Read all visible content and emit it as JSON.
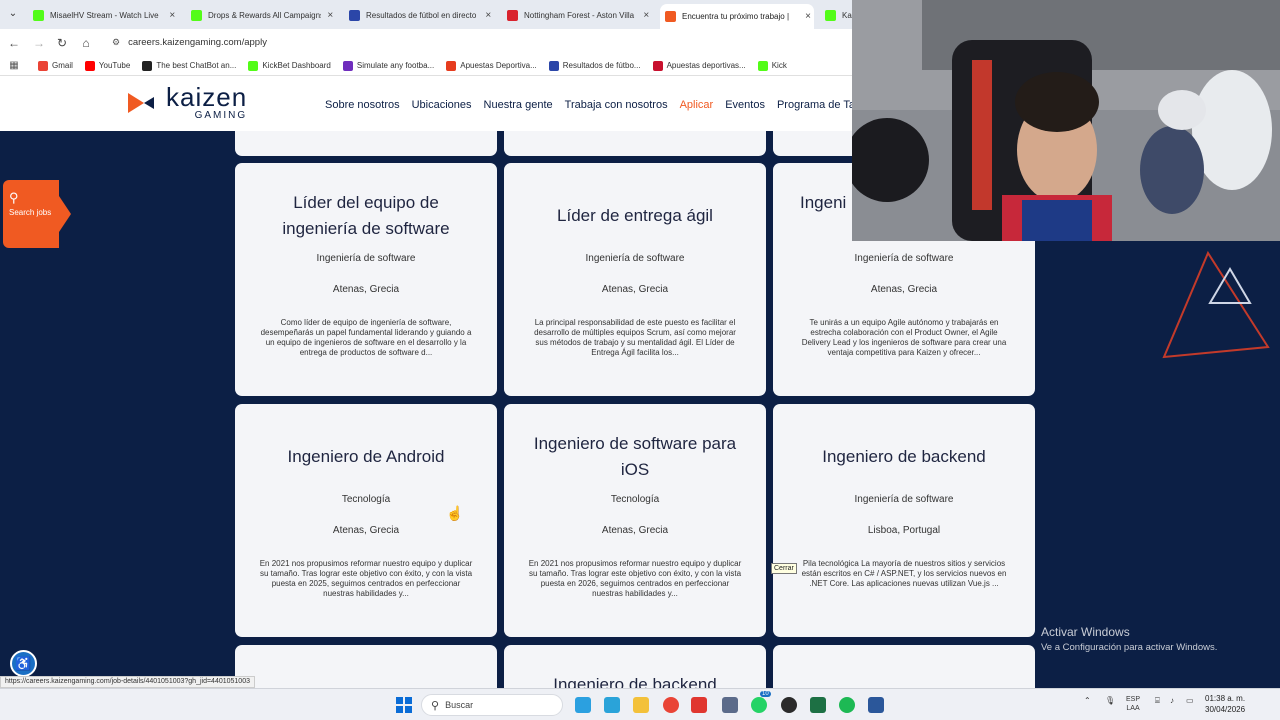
{
  "browser": {
    "tabs": [
      {
        "title": "MisaelHV Stream - Watch Live",
        "color": "#53fc18",
        "active": false
      },
      {
        "title": "Drops & Rewards All Campaigns",
        "color": "#53fc18",
        "active": false
      },
      {
        "title": "Resultados de fútbol en directo",
        "color": "#2b46a8",
        "active": false
      },
      {
        "title": "Nottingham Forest - Aston Villa",
        "color": "#d9232e",
        "active": false
      },
      {
        "title": "Encuentra tu próximo trabajo |",
        "color": "#f05a22",
        "active": true
      },
      {
        "title": "Ka",
        "color": "#53fc18",
        "active": false
      }
    ],
    "url": "careers.kaizengaming.com/apply",
    "bookmarks": [
      {
        "label": "Gmail",
        "color": "#ea4335"
      },
      {
        "label": "YouTube",
        "color": "#ff0000"
      },
      {
        "label": "The best ChatBot an...",
        "color": "#222222"
      },
      {
        "label": "KickBet Dashboard",
        "color": "#53fc18"
      },
      {
        "label": "Simulate any footba...",
        "color": "#6f2dbd"
      },
      {
        "label": "Apuestas Deportiva...",
        "color": "#e63c1e"
      },
      {
        "label": "Resultados de fútbo...",
        "color": "#2b46a8"
      },
      {
        "label": "Apuestas deportivas...",
        "color": "#c8102e"
      },
      {
        "label": "Kick",
        "color": "#53fc18"
      }
    ]
  },
  "site": {
    "logo_word": "kaizen",
    "logo_sub": "GAMING",
    "brand_color": "#f05a22",
    "nav": [
      {
        "label": "Sobre nosotros",
        "active": false
      },
      {
        "label": "Ubicaciones",
        "active": false
      },
      {
        "label": "Nuestra gente",
        "active": false
      },
      {
        "label": "Trabaja con nosotros",
        "active": false
      },
      {
        "label": "Aplicar",
        "active": true
      },
      {
        "label": "Eventos",
        "active": false
      },
      {
        "label": "Programa de Talen",
        "active": false
      }
    ]
  },
  "search_jobs": {
    "icon": "search-icon",
    "label": "Search jobs"
  },
  "jobs": [
    {
      "title": "Líder del equipo de ingeniería de software",
      "department": "Ingeniería de software",
      "location": "Atenas, Grecia",
      "description": "Como líder de equipo de ingeniería de software, desempeñarás un papel fundamental liderando y guiando a un equipo de ingenieros de software en el desarrollo y la entrega de productos de software d..."
    },
    {
      "title": "Líder de entrega ágil",
      "department": "Ingeniería de software",
      "location": "Atenas, Grecia",
      "description": "La principal responsabilidad de este puesto es facilitar el desarrollo de múltiples equipos Scrum, así como mejorar sus métodos de trabajo y su mentalidad ágil. El Líder de Entrega Ágil facilita los..."
    },
    {
      "title": "Ingeni",
      "department": "Ingeniería de software",
      "location": "Atenas, Grecia",
      "description": "Te unirás a un equipo Agile autónomo y trabajarás en estrecha colaboración con el Product Owner, el Agile Delivery Lead y los ingenieros de software para crear una ventaja competitiva para Kaizen y ofrecer..."
    },
    {
      "title": "Ingeniero de Android",
      "department": "Tecnología",
      "location": "Atenas, Grecia",
      "description": "En 2021 nos propusimos reformar nuestro equipo y duplicar su tamaño. Tras lograr este objetivo con éxito, y con la vista puesta en 2025, seguimos centrados en perfeccionar nuestras habilidades y..."
    },
    {
      "title": "Ingeniero de software para iOS",
      "department": "Tecnología",
      "location": "Atenas, Grecia",
      "description": "En 2021 nos propusimos reformar nuestro equipo y duplicar su tamaño. Tras lograr este objetivo con éxito, y con la vista puesta en 2026, seguimos centrados en perfeccionar nuestras habilidades y..."
    },
    {
      "title": "Ingeniero de backend",
      "department": "Ingeniería de software",
      "location": "Lisboa, Portugal",
      "description": "Pila tecnológica La mayoría de nuestros sitios y servicios están escritos en C# / ASP.NET, y los servicios nuevos en .NET Core. Las aplicaciones nuevas utilizan Vue.js ..."
    },
    {
      "title": "Ingeniero de backend",
      "department": "",
      "location": "",
      "description": ""
    }
  ],
  "tooltip": "Cerrar",
  "status_url": "https://careers.kaizengaming.com/job-details/4401051003?gh_jid=4401051003",
  "windows_watermark": {
    "line1": "Activar Windows",
    "line2": "Ve a Configuración para activar Windows."
  },
  "taskbar": {
    "search_placeholder": "Buscar",
    "lang_top": "ESP",
    "lang_bottom": "LAA",
    "time": "01:38 a. m.",
    "date": "30/04/2026",
    "whatsapp_badge": "10"
  }
}
